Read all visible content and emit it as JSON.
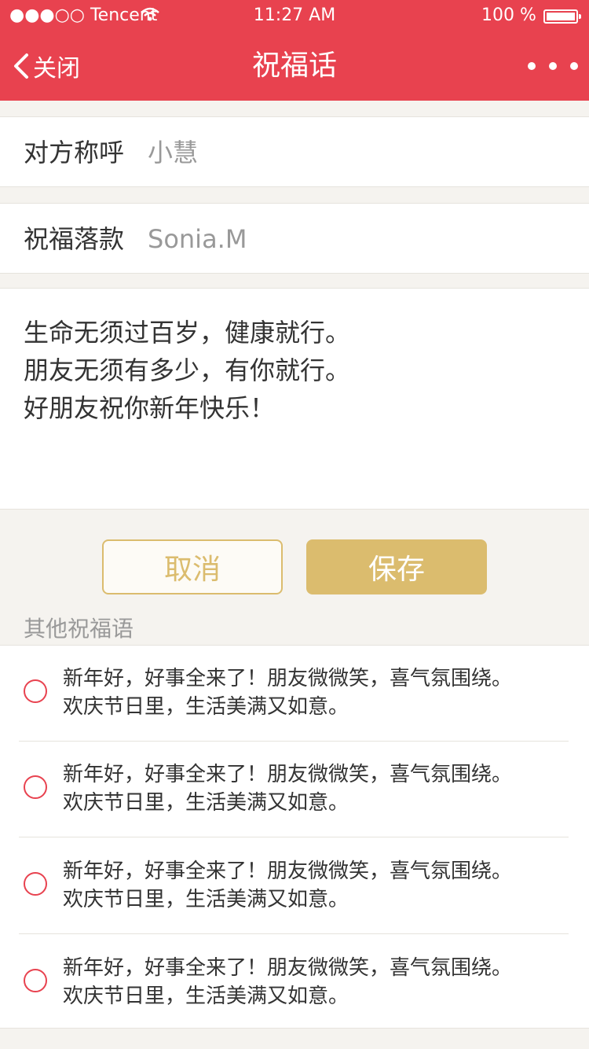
{
  "status_bar": {
    "carrier": "●●●○○ Tencent",
    "wifi_icon": "wifi-icon",
    "time": "11:27 AM",
    "battery_percent": "100 %"
  },
  "nav": {
    "back_label": "关闭",
    "title": "祝福话",
    "more_icon": "more-dots-icon"
  },
  "form": {
    "recipient_label": "对方称呼",
    "recipient_value": "小慧",
    "signature_label": "祝福落款",
    "signature_value": "Sonia.M"
  },
  "message": {
    "lines": [
      "生命无须过百岁，健康就行。",
      "朋友无须有多少，有你就行。",
      "好朋友祝你新年快乐！"
    ]
  },
  "buttons": {
    "cancel": "取消",
    "save": "保存"
  },
  "other": {
    "section_title": "其他祝福语",
    "items": [
      {
        "line1": "新年好，好事全来了！朋友微微笑，喜气氛围绕。",
        "line2": "欢庆节日里，生活美满又如意。"
      },
      {
        "line1": "新年好，好事全来了！朋友微微笑，喜气氛围绕。",
        "line2": "欢庆节日里，生活美满又如意。"
      },
      {
        "line1": "新年好，好事全来了！朋友微微笑，喜气氛围绕。",
        "line2": "欢庆节日里，生活美满又如意。"
      },
      {
        "line1": "新年好，好事全来了！朋友微微笑，喜气氛围绕。",
        "line2": "欢庆节日里，生活美满又如意。"
      }
    ]
  },
  "colors": {
    "header": "#e8424f",
    "accent_gold": "#dbbc6e",
    "background": "#f5f3ef"
  }
}
